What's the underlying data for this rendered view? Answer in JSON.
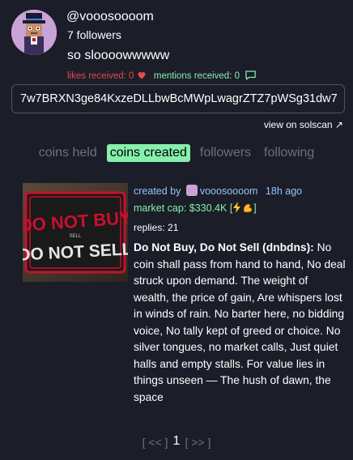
{
  "profile": {
    "username": "@vooosoooom",
    "followers": "7 followers",
    "bio": "so sloooowwwww",
    "likes_label": "likes received: 0",
    "mentions_label": "mentions received: 0",
    "avatar_icon": "pixel-avatar-top-hat"
  },
  "address": {
    "value": "7w7BRXN3ge84KxzeDLLbwBcMWpLwagrZTZ7pWSg31dw7",
    "solscan_label": "view on solscan ↗"
  },
  "tabs": [
    {
      "label": "coins held",
      "active": false
    },
    {
      "label": "coins created",
      "active": true
    },
    {
      "label": "followers",
      "active": false
    },
    {
      "label": "following",
      "active": false
    }
  ],
  "coin": {
    "created_by_label": "created by",
    "creator": "vooosoooom",
    "age": "18h ago",
    "market_cap": "market cap: $330.4K [",
    "market_cap_end": "]",
    "replies": "replies: 21",
    "name": "Do Not Buy, Do Not Sell (dnbdns):",
    "description": "No coin shall pass from hand to hand, No deal struck upon demand. The weight of wealth, the price of gain, Are whispers lost in winds of rain. No barter here, no bidding voice, No tally kept of greed or choice. No silver tongues, no market calls, Just quiet halls and empty stalls. For value lies in things unseen — The hush of dawn, the space",
    "image_text": {
      "line1": "DO NOT BUY",
      "small": "SELL",
      "line2": "DO NOT SELL"
    }
  },
  "pager": {
    "prev": "[ << ]",
    "page": "1",
    "next": "[ >> ]"
  },
  "colors": {
    "background": "#1b1d28",
    "accent_green": "#86efac",
    "likes_red": "#e5484d",
    "link_blue": "#93c5fd"
  }
}
